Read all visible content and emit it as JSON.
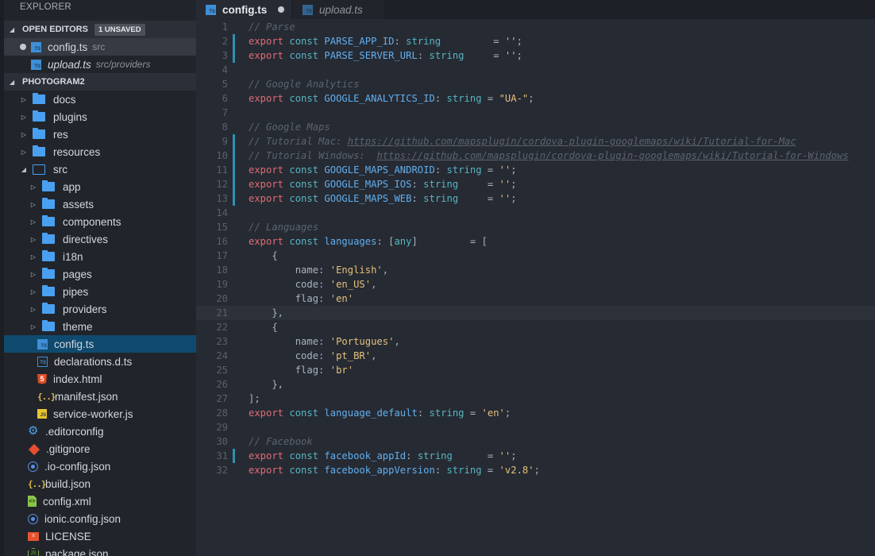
{
  "sidebar": {
    "title": "EXPLORER",
    "open_editors": {
      "label": "OPEN EDITORS",
      "badge": "1 UNSAVED",
      "items": [
        {
          "name": "config.ts",
          "desc": "src",
          "dirty": true
        },
        {
          "name": "upload.ts",
          "desc": "src/providers",
          "dirty": false
        }
      ]
    },
    "project": {
      "label": "PHOTOGRAM2",
      "items": [
        {
          "name": "docs",
          "type": "folder"
        },
        {
          "name": "plugins",
          "type": "folder"
        },
        {
          "name": "res",
          "type": "folder"
        },
        {
          "name": "resources",
          "type": "folder"
        },
        {
          "name": "src",
          "type": "folder-open"
        },
        {
          "name": "app",
          "type": "folder"
        },
        {
          "name": "assets",
          "type": "folder"
        },
        {
          "name": "components",
          "type": "folder"
        },
        {
          "name": "directives",
          "type": "folder"
        },
        {
          "name": "i18n",
          "type": "folder"
        },
        {
          "name": "pages",
          "type": "folder"
        },
        {
          "name": "pipes",
          "type": "folder"
        },
        {
          "name": "providers",
          "type": "folder"
        },
        {
          "name": "theme",
          "type": "folder"
        },
        {
          "name": "config.ts",
          "type": "ts"
        },
        {
          "name": "declarations.d.ts",
          "type": "ts-dark"
        },
        {
          "name": "index.html",
          "type": "html5"
        },
        {
          "name": "manifest.json",
          "type": "json"
        },
        {
          "name": "service-worker.js",
          "type": "js"
        },
        {
          "name": ".editorconfig",
          "type": "gear"
        },
        {
          "name": ".gitignore",
          "type": "git"
        },
        {
          "name": ".io-config.json",
          "type": "ionic"
        },
        {
          "name": "build.json",
          "type": "json"
        },
        {
          "name": "config.xml",
          "type": "xml"
        },
        {
          "name": "ionic.config.json",
          "type": "ionic"
        },
        {
          "name": "LICENSE",
          "type": "license"
        },
        {
          "name": "package.json",
          "type": "node"
        }
      ]
    }
  },
  "tabs": [
    {
      "label": "config.ts",
      "active": true,
      "dirty": true
    },
    {
      "label": "upload.ts",
      "active": false,
      "dirty": false
    }
  ],
  "editor": {
    "current_line": 21,
    "modified_lines": [
      2,
      3,
      9,
      10,
      11,
      12,
      13,
      31
    ],
    "lines": [
      [
        [
          "cm",
          "// Parse"
        ]
      ],
      [
        [
          "kw",
          "export"
        ],
        [
          "pn",
          " "
        ],
        [
          "st",
          "const"
        ],
        [
          "pn",
          " "
        ],
        [
          "id",
          "PARSE_APP_ID"
        ],
        [
          "pn",
          ": "
        ],
        [
          "ty",
          "string"
        ],
        [
          "pn",
          "         = "
        ],
        [
          "str",
          "''"
        ],
        [
          "pn",
          ";"
        ]
      ],
      [
        [
          "kw",
          "export"
        ],
        [
          "pn",
          " "
        ],
        [
          "st",
          "const"
        ],
        [
          "pn",
          " "
        ],
        [
          "id",
          "PARSE_SERVER_URL"
        ],
        [
          "pn",
          ": "
        ],
        [
          "ty",
          "string"
        ],
        [
          "pn",
          "     = "
        ],
        [
          "str",
          "''"
        ],
        [
          "pn",
          ";"
        ]
      ],
      [],
      [
        [
          "cm",
          "// Google Analytics"
        ]
      ],
      [
        [
          "kw",
          "export"
        ],
        [
          "pn",
          " "
        ],
        [
          "st",
          "const"
        ],
        [
          "pn",
          " "
        ],
        [
          "id",
          "GOOGLE_ANALYTICS_ID"
        ],
        [
          "pn",
          ": "
        ],
        [
          "ty",
          "string"
        ],
        [
          "pn",
          " = "
        ],
        [
          "str",
          "\"UA-\""
        ],
        [
          "pn",
          ";"
        ]
      ],
      [],
      [
        [
          "cm",
          "// Google Maps"
        ]
      ],
      [
        [
          "cm",
          "// Tutorial Mac: "
        ],
        [
          "url",
          "https://github.com/mapsplugin/cordova-plugin-googlemaps/wiki/Tutorial-for-Mac"
        ]
      ],
      [
        [
          "cm",
          "// Tutorial Windows:  "
        ],
        [
          "url",
          "https://github.com/mapsplugin/cordova-plugin-googlemaps/wiki/Tutorial-for-Windows"
        ]
      ],
      [
        [
          "kw",
          "export"
        ],
        [
          "pn",
          " "
        ],
        [
          "st",
          "const"
        ],
        [
          "pn",
          " "
        ],
        [
          "id",
          "GOOGLE_MAPS_ANDROID"
        ],
        [
          "pn",
          ": "
        ],
        [
          "ty",
          "string"
        ],
        [
          "pn",
          " = "
        ],
        [
          "str",
          "''"
        ],
        [
          "pn",
          ";"
        ]
      ],
      [
        [
          "kw",
          "export"
        ],
        [
          "pn",
          " "
        ],
        [
          "st",
          "const"
        ],
        [
          "pn",
          " "
        ],
        [
          "id",
          "GOOGLE_MAPS_IOS"
        ],
        [
          "pn",
          ": "
        ],
        [
          "ty",
          "string"
        ],
        [
          "pn",
          "     = "
        ],
        [
          "str",
          "''"
        ],
        [
          "pn",
          ";"
        ]
      ],
      [
        [
          "kw",
          "export"
        ],
        [
          "pn",
          " "
        ],
        [
          "st",
          "const"
        ],
        [
          "pn",
          " "
        ],
        [
          "id",
          "GOOGLE_MAPS_WEB"
        ],
        [
          "pn",
          ": "
        ],
        [
          "ty",
          "string"
        ],
        [
          "pn",
          "     = "
        ],
        [
          "str",
          "''"
        ],
        [
          "pn",
          ";"
        ]
      ],
      [],
      [
        [
          "cm",
          "// Languages"
        ]
      ],
      [
        [
          "kw",
          "export"
        ],
        [
          "pn",
          " "
        ],
        [
          "st",
          "const"
        ],
        [
          "pn",
          " "
        ],
        [
          "id",
          "languages"
        ],
        [
          "pn",
          ": ["
        ],
        [
          "ty",
          "any"
        ],
        [
          "pn",
          "]         = ["
        ]
      ],
      [
        [
          "pn",
          "    {"
        ]
      ],
      [
        [
          "pn",
          "        name: "
        ],
        [
          "str",
          "'English'"
        ],
        [
          "pn",
          ","
        ]
      ],
      [
        [
          "pn",
          "        code: "
        ],
        [
          "str",
          "'en_US'"
        ],
        [
          "pn",
          ","
        ]
      ],
      [
        [
          "pn",
          "        flag: "
        ],
        [
          "str",
          "'en'"
        ]
      ],
      [
        [
          "pn",
          "    },"
        ]
      ],
      [
        [
          "pn",
          "    {"
        ]
      ],
      [
        [
          "pn",
          "        name: "
        ],
        [
          "str",
          "'Portugues'"
        ],
        [
          "pn",
          ","
        ]
      ],
      [
        [
          "pn",
          "        code: "
        ],
        [
          "str",
          "'pt_BR'"
        ],
        [
          "pn",
          ","
        ]
      ],
      [
        [
          "pn",
          "        flag: "
        ],
        [
          "str",
          "'br'"
        ]
      ],
      [
        [
          "pn",
          "    },"
        ]
      ],
      [
        [
          "pn",
          "];"
        ]
      ],
      [
        [
          "kw",
          "export"
        ],
        [
          "pn",
          " "
        ],
        [
          "st",
          "const"
        ],
        [
          "pn",
          " "
        ],
        [
          "id",
          "language_default"
        ],
        [
          "pn",
          ": "
        ],
        [
          "ty",
          "string"
        ],
        [
          "pn",
          " = "
        ],
        [
          "str",
          "'en'"
        ],
        [
          "pn",
          ";"
        ]
      ],
      [],
      [
        [
          "cm",
          "// Facebook"
        ]
      ],
      [
        [
          "kw",
          "export"
        ],
        [
          "pn",
          " "
        ],
        [
          "st",
          "const"
        ],
        [
          "pn",
          " "
        ],
        [
          "id",
          "facebook_appId"
        ],
        [
          "pn",
          ": "
        ],
        [
          "ty",
          "string"
        ],
        [
          "pn",
          "      = "
        ],
        [
          "str",
          "''"
        ],
        [
          "pn",
          ";"
        ]
      ],
      [
        [
          "kw",
          "export"
        ],
        [
          "pn",
          " "
        ],
        [
          "st",
          "const"
        ],
        [
          "pn",
          " "
        ],
        [
          "id",
          "facebook_appVersion"
        ],
        [
          "pn",
          ": "
        ],
        [
          "ty",
          "string"
        ],
        [
          "pn",
          " = "
        ],
        [
          "str",
          "'v2.8'"
        ],
        [
          "pn",
          ";"
        ]
      ]
    ]
  }
}
